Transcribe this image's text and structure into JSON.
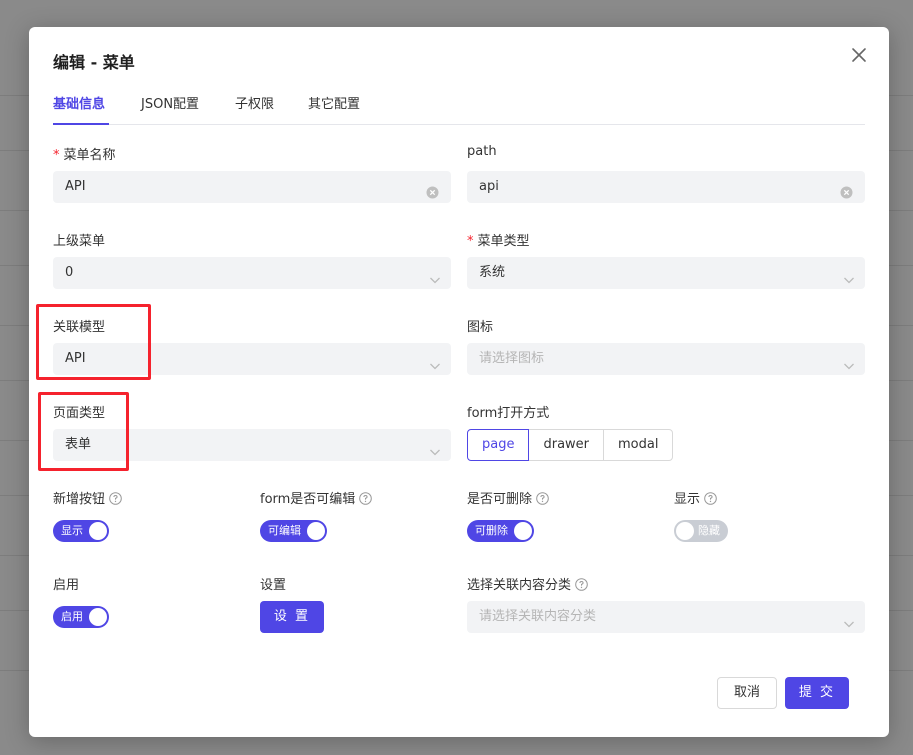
{
  "modal": {
    "title": "编辑 - 菜单"
  },
  "tabs": [
    {
      "label": "基础信息",
      "active": true
    },
    {
      "label": "JSON配置"
    },
    {
      "label": "子权限"
    },
    {
      "label": "其它配置"
    }
  ],
  "fields": {
    "menu_name": {
      "label": "菜单名称",
      "required": true,
      "value": "API"
    },
    "path": {
      "label": "path",
      "value": "api"
    },
    "parent_menu": {
      "label": "上级菜单",
      "value": "0"
    },
    "menu_type": {
      "label": "菜单类型",
      "required": true,
      "value": "系统"
    },
    "linked_model": {
      "label": "关联模型",
      "value": "API"
    },
    "icon": {
      "label": "图标",
      "placeholder": "请选择图标"
    },
    "page_type": {
      "label": "页面类型",
      "value": "表单"
    },
    "form_open_mode": {
      "label": "form打开方式",
      "options": [
        "page",
        "drawer",
        "modal"
      ],
      "selected": "page"
    },
    "add_button": {
      "label": "新增按钮",
      "switch_text": "显示",
      "on": true
    },
    "form_editable": {
      "label": "form是否可编辑",
      "switch_text": "可编辑",
      "on": true
    },
    "deletable": {
      "label": "是否可删除",
      "switch_text": "可删除",
      "on": true
    },
    "display": {
      "label": "显示",
      "switch_text": "隐藏",
      "on": false
    },
    "enabled": {
      "label": "启用",
      "switch_text": "启用",
      "on": true
    },
    "settings": {
      "label": "设置",
      "button": "设 置"
    },
    "content_category": {
      "label": "选择关联内容分类",
      "placeholder": "请选择关联内容分类"
    }
  },
  "footer": {
    "cancel": "取消",
    "submit": "提 交"
  },
  "colors": {
    "primary": "#4f46e5",
    "field_bg": "#f2f3f5",
    "required": "#f5222d",
    "highlight": "#f5222d"
  }
}
